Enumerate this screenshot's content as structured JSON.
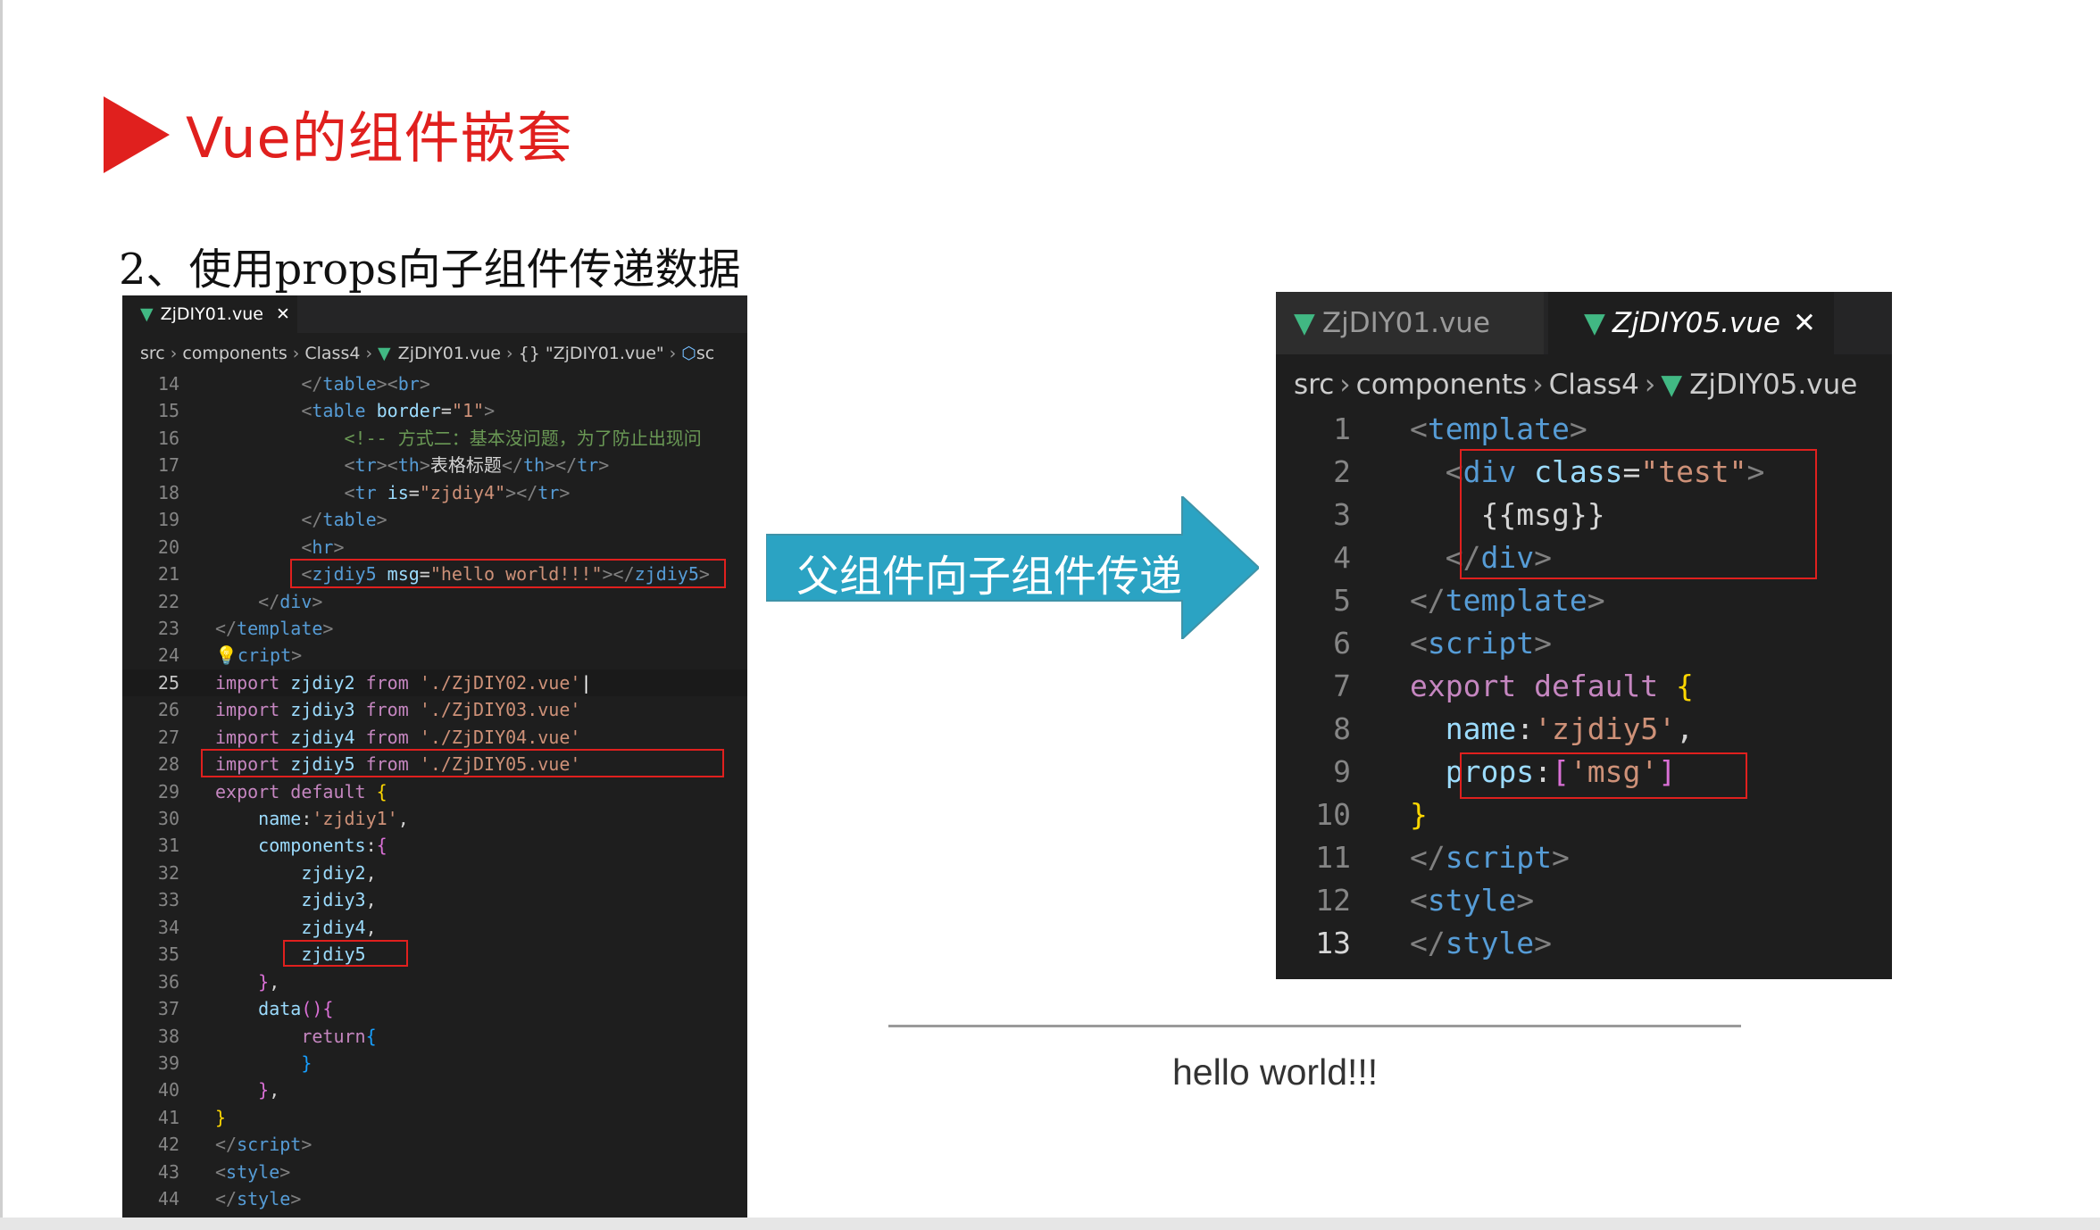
{
  "slide": {
    "title": "Vue的组件嵌套",
    "subtitle": "2、使用props向子组件传递数据",
    "arrow_label": "父组件向子组件传递",
    "output_text": "hello world!!!"
  },
  "left_editor": {
    "tab_label": "ZjDIY01.vue",
    "close_glyph": "✕",
    "breadcrumb": [
      "src",
      "components",
      "Class4",
      "ZjDIY01.vue",
      "{} \"ZjDIY01.vue\"",
      "sc"
    ],
    "line_numbers": [
      "14",
      "15",
      "16",
      "17",
      "18",
      "19",
      "20",
      "21",
      "22",
      "23",
      "24",
      "25",
      "26",
      "27",
      "28",
      "29",
      "30",
      "31",
      "32",
      "33",
      "34",
      "35",
      "36",
      "37",
      "38",
      "39",
      "40",
      "41",
      "42",
      "43",
      "44"
    ],
    "current_line": "25"
  },
  "right_editor": {
    "tabs": [
      "ZjDIY01.vue",
      "ZjDIY05.vue"
    ],
    "close_glyph": "✕",
    "breadcrumb": [
      "src",
      "components",
      "Class4",
      "ZjDIY05.vue"
    ],
    "line_numbers": [
      "1",
      "2",
      "3",
      "4",
      "5",
      "6",
      "7",
      "8",
      "9",
      "10",
      "11",
      "12",
      "13"
    ],
    "current_line": "13"
  },
  "colors": {
    "accent_red": "#e0201e",
    "arrow_teal": "#2ba3c3",
    "editor_bg": "#1e1e1e",
    "vue_green": "#41b883"
  }
}
